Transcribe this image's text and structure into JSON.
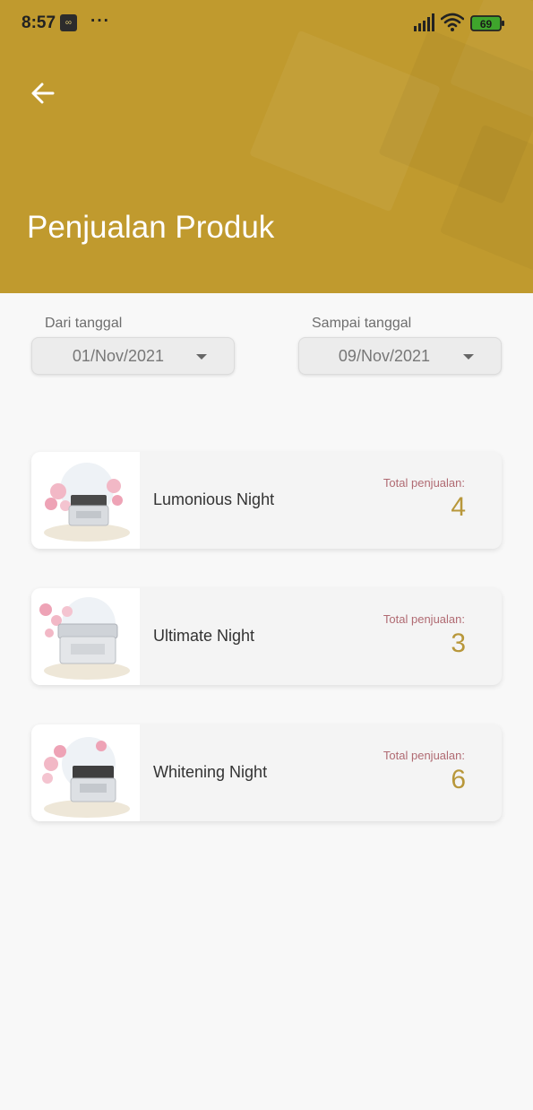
{
  "status_bar": {
    "time": "8:57",
    "app_icon": "infinity-icon",
    "app_icon_glyph": "∞",
    "more_dots": "···",
    "battery_level": "69"
  },
  "header": {
    "back_icon": "arrow-left-icon",
    "title": "Penjualan Produk",
    "color": "#c09a2e"
  },
  "filters": {
    "from": {
      "label": "Dari tanggal",
      "value": "01/Nov/2021"
    },
    "to": {
      "label": "Sampai tanggal",
      "value": "09/Nov/2021"
    }
  },
  "sales_label": "Total penjualan:",
  "products": [
    {
      "name": "Lumonious Night",
      "sales_label": "Total penjualan:",
      "total": "4",
      "image": "night-cream-jar-image"
    },
    {
      "name": "Ultimate Night",
      "sales_label": "Total penjualan:",
      "total": "3",
      "image": "night-cream-jar-image"
    },
    {
      "name": "Whitening Night",
      "sales_label": "Total penjualan:",
      "total": "6",
      "image": "night-cream-jar-image"
    }
  ],
  "colors": {
    "accent": "#c09a2e",
    "sales_value": "#b8973a",
    "sales_label": "#b06a72"
  }
}
